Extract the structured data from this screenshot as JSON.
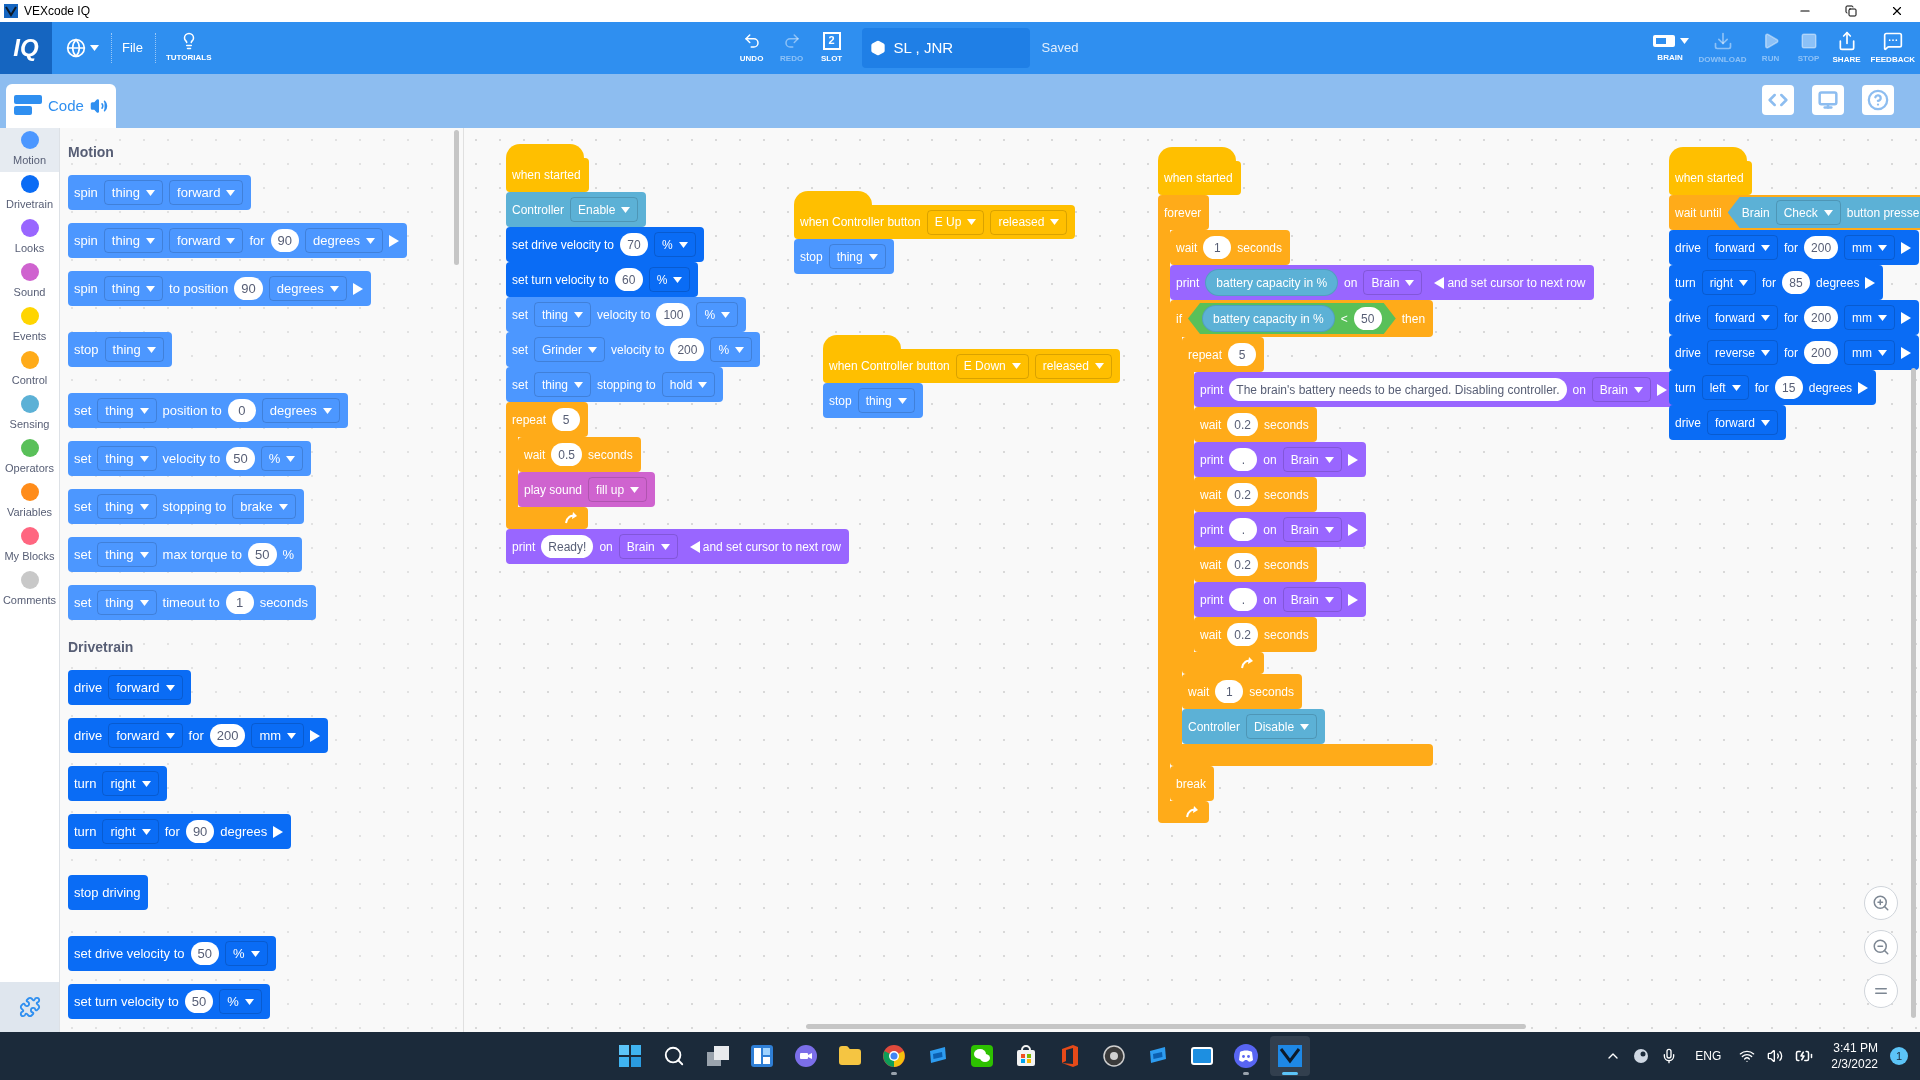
{
  "window": {
    "title": "VEXcode IQ"
  },
  "toolbar": {
    "logo": "IQ",
    "file_menu": "File",
    "tutorials": "TUTORIALS",
    "slot_number": "2",
    "project_name": "SL , JNR",
    "save_status": "Saved",
    "center_buttons": [
      {
        "kind": "undo",
        "label": "UNDO",
        "disabled": false
      },
      {
        "kind": "redo",
        "label": "REDO",
        "disabled": true
      },
      {
        "kind": "slot",
        "label": "SLOT",
        "disabled": false
      }
    ],
    "right_buttons": [
      {
        "kind": "brain",
        "label": "BRAIN",
        "disabled": false
      },
      {
        "kind": "download",
        "label": "DOWNLOAD",
        "disabled": true
      },
      {
        "kind": "run",
        "label": "RUN",
        "disabled": true
      },
      {
        "kind": "stop",
        "label": "STOP",
        "disabled": true
      },
      {
        "kind": "share",
        "label": "SHARE",
        "disabled": false
      },
      {
        "kind": "feedback",
        "label": "FEEDBACK",
        "disabled": false
      }
    ]
  },
  "tabs": [
    {
      "label": "Code",
      "selected": true
    }
  ],
  "categories": [
    {
      "label": "Motion",
      "color": "#4c97ff",
      "selected": true
    },
    {
      "label": "Drivetrain",
      "color": "#0a6cf5",
      "selected": false
    },
    {
      "label": "Looks",
      "color": "#9966ff",
      "selected": false
    },
    {
      "label": "Sound",
      "color": "#cf63cf",
      "selected": false
    },
    {
      "label": "Events",
      "color": "#ffd500",
      "selected": false
    },
    {
      "label": "Control",
      "color": "#ffab19",
      "selected": false
    },
    {
      "label": "Sensing",
      "color": "#5cb1d6",
      "selected": false
    },
    {
      "label": "Operators",
      "color": "#59c059",
      "selected": false
    },
    {
      "label": "Variables",
      "color": "#ff8c1a",
      "selected": false
    },
    {
      "label": "My Blocks",
      "color": "#ff6680",
      "selected": false
    },
    {
      "label": "Comments",
      "color": "#c8c8c8",
      "selected": false
    }
  ],
  "palette": [
    {
      "title": "Motion",
      "blocks": [
        {
          "kind": "stack",
          "color": "#4c97ff",
          "parts": [
            {
              "kind": "text",
              "text": "spin"
            },
            {
              "kind": "dropdown",
              "text": "thing"
            },
            {
              "kind": "dropdown",
              "text": "forward"
            }
          ]
        },
        {
          "kind": "stack",
          "color": "#4c97ff",
          "parts": [
            {
              "kind": "text",
              "text": "spin"
            },
            {
              "kind": "dropdown",
              "text": "thing"
            },
            {
              "kind": "dropdown",
              "text": "forward"
            },
            {
              "kind": "text",
              "text": "for"
            },
            {
              "kind": "number",
              "text": "90"
            },
            {
              "kind": "dropdown",
              "text": "degrees"
            },
            {
              "kind": "expand"
            }
          ]
        },
        {
          "kind": "stack",
          "color": "#4c97ff",
          "parts": [
            {
              "kind": "text",
              "text": "spin"
            },
            {
              "kind": "dropdown",
              "text": "thing"
            },
            {
              "kind": "text",
              "text": "to position"
            },
            {
              "kind": "number",
              "text": "90"
            },
            {
              "kind": "dropdown",
              "text": "degrees"
            },
            {
              "kind": "expand"
            }
          ]
        },
        {
          "kind": "stack",
          "color": "#4c97ff",
          "parts": [
            {
              "kind": "text",
              "text": "stop"
            },
            {
              "kind": "dropdown",
              "text": "thing"
            }
          ]
        },
        {
          "kind": "stack",
          "color": "#4c97ff",
          "parts": [
            {
              "kind": "text",
              "text": "set"
            },
            {
              "kind": "dropdown",
              "text": "thing"
            },
            {
              "kind": "text",
              "text": "position to"
            },
            {
              "kind": "number",
              "text": "0"
            },
            {
              "kind": "dropdown",
              "text": "degrees"
            }
          ]
        },
        {
          "kind": "stack",
          "color": "#4c97ff",
          "parts": [
            {
              "kind": "text",
              "text": "set"
            },
            {
              "kind": "dropdown",
              "text": "thing"
            },
            {
              "kind": "text",
              "text": "velocity to"
            },
            {
              "kind": "number",
              "text": "50"
            },
            {
              "kind": "dropdown",
              "text": "%"
            }
          ]
        },
        {
          "kind": "stack",
          "color": "#4c97ff",
          "parts": [
            {
              "kind": "text",
              "text": "set"
            },
            {
              "kind": "dropdown",
              "text": "thing"
            },
            {
              "kind": "text",
              "text": "stopping to"
            },
            {
              "kind": "dropdown",
              "text": "brake"
            }
          ]
        },
        {
          "kind": "stack",
          "color": "#4c97ff",
          "parts": [
            {
              "kind": "text",
              "text": "set"
            },
            {
              "kind": "dropdown",
              "text": "thing"
            },
            {
              "kind": "text",
              "text": "max torque to"
            },
            {
              "kind": "number",
              "text": "50"
            },
            {
              "kind": "text",
              "text": "%"
            }
          ]
        },
        {
          "kind": "stack",
          "color": "#4c97ff",
          "parts": [
            {
              "kind": "text",
              "text": "set"
            },
            {
              "kind": "dropdown",
              "text": "thing"
            },
            {
              "kind": "text",
              "text": "timeout to"
            },
            {
              "kind": "number",
              "text": "1"
            },
            {
              "kind": "text",
              "text": "seconds"
            }
          ]
        }
      ]
    },
    {
      "title": "Drivetrain",
      "blocks": [
        {
          "kind": "stack",
          "color": "#0a6cf5",
          "parts": [
            {
              "kind": "text",
              "text": "drive"
            },
            {
              "kind": "dropdown",
              "text": "forward"
            }
          ]
        },
        {
          "kind": "stack",
          "color": "#0a6cf5",
          "parts": [
            {
              "kind": "text",
              "text": "drive"
            },
            {
              "kind": "dropdown",
              "text": "forward"
            },
            {
              "kind": "text",
              "text": "for"
            },
            {
              "kind": "number",
              "text": "200"
            },
            {
              "kind": "dropdown",
              "text": "mm"
            },
            {
              "kind": "expand"
            }
          ]
        },
        {
          "kind": "stack",
          "color": "#0a6cf5",
          "parts": [
            {
              "kind": "text",
              "text": "turn"
            },
            {
              "kind": "dropdown",
              "text": "right"
            }
          ]
        },
        {
          "kind": "stack",
          "color": "#0a6cf5",
          "parts": [
            {
              "kind": "text",
              "text": "turn"
            },
            {
              "kind": "dropdown",
              "text": "right"
            },
            {
              "kind": "text",
              "text": "for"
            },
            {
              "kind": "number",
              "text": "90"
            },
            {
              "kind": "text",
              "text": "degrees"
            },
            {
              "kind": "expand"
            }
          ]
        },
        {
          "kind": "stack",
          "color": "#0a6cf5",
          "parts": [
            {
              "kind": "text",
              "text": "stop driving"
            }
          ]
        },
        {
          "kind": "stack",
          "color": "#0a6cf5",
          "parts": [
            {
              "kind": "text",
              "text": "set drive velocity to"
            },
            {
              "kind": "number",
              "text": "50"
            },
            {
              "kind": "dropdown",
              "text": "%"
            }
          ]
        },
        {
          "kind": "stack",
          "color": "#0a6cf5",
          "parts": [
            {
              "kind": "text",
              "text": "set turn velocity to"
            },
            {
              "kind": "number",
              "text": "50"
            },
            {
              "kind": "dropdown",
              "text": "%"
            }
          ]
        }
      ]
    }
  ],
  "scripts": [
    {
      "blocks": [
        {
          "kind": "hat",
          "color": "#ffbf00",
          "parts": [
            {
              "kind": "text",
              "text": "when started"
            }
          ]
        },
        {
          "kind": "stack",
          "color": "#5cb1d6",
          "parts": [
            {
              "kind": "text",
              "text": "Controller"
            },
            {
              "kind": "dropdown",
              "text": "Enable"
            }
          ]
        },
        {
          "kind": "stack",
          "color": "#0a6cf5",
          "parts": [
            {
              "kind": "text",
              "text": "set drive velocity to"
            },
            {
              "kind": "number",
              "text": "70"
            },
            {
              "kind": "dropdown",
              "text": "%"
            }
          ]
        },
        {
          "kind": "stack",
          "color": "#0a6cf5",
          "parts": [
            {
              "kind": "text",
              "text": "set turn velocity to"
            },
            {
              "kind": "number",
              "text": "60"
            },
            {
              "kind": "dropdown",
              "text": "%"
            }
          ]
        },
        {
          "kind": "stack",
          "color": "#4c97ff",
          "parts": [
            {
              "kind": "text",
              "text": "set"
            },
            {
              "kind": "dropdown",
              "text": "thing"
            },
            {
              "kind": "text",
              "text": "velocity to"
            },
            {
              "kind": "number",
              "text": "100"
            },
            {
              "kind": "dropdown",
              "text": "%"
            }
          ]
        },
        {
          "kind": "stack",
          "color": "#4c97ff",
          "parts": [
            {
              "kind": "text",
              "text": "set"
            },
            {
              "kind": "dropdown",
              "text": "Grinder"
            },
            {
              "kind": "text",
              "text": "velocity to"
            },
            {
              "kind": "number",
              "text": "200"
            },
            {
              "kind": "dropdown",
              "text": "%"
            }
          ]
        },
        {
          "kind": "stack",
          "color": "#4c97ff",
          "parts": [
            {
              "kind": "text",
              "text": "set"
            },
            {
              "kind": "dropdown",
              "text": "thing"
            },
            {
              "kind": "text",
              "text": "stopping to"
            },
            {
              "kind": "dropdown",
              "text": "hold"
            }
          ]
        },
        {
          "kind": "loop",
          "color": "#ffab19",
          "parts": [
            {
              "kind": "text",
              "text": "repeat"
            },
            {
              "kind": "number",
              "text": "5"
            }
          ],
          "children": [
            {
              "kind": "stack",
              "color": "#ffab19",
              "parts": [
                {
                  "kind": "text",
                  "text": "wait"
                },
                {
                  "kind": "number",
                  "text": "0.5"
                },
                {
                  "kind": "text",
                  "text": "seconds"
                }
              ]
            },
            {
              "kind": "stack",
              "color": "#cf63cf",
              "parts": [
                {
                  "kind": "text",
                  "text": "play sound"
                },
                {
                  "kind": "dropdown",
                  "text": "fill up"
                }
              ]
            }
          ]
        },
        {
          "kind": "stack",
          "color": "#9966ff",
          "parts": [
            {
              "kind": "text",
              "text": "print"
            },
            {
              "kind": "number",
              "text": "Ready!"
            },
            {
              "kind": "text",
              "text": "on"
            },
            {
              "kind": "dropdown",
              "text": "Brain"
            },
            {
              "kind": "collapse",
              "text": "and set cursor to next row"
            }
          ]
        }
      ]
    },
    {
      "blocks": [
        {
          "kind": "hat",
          "color": "#ffbf00",
          "parts": [
            {
              "kind": "text",
              "text": "when Controller button"
            },
            {
              "kind": "dropdown",
              "text": "E Up"
            },
            {
              "kind": "dropdown",
              "text": "released"
            }
          ]
        },
        {
          "kind": "stack",
          "color": "#4c97ff",
          "parts": [
            {
              "kind": "text",
              "text": "stop"
            },
            {
              "kind": "dropdown",
              "text": "thing"
            }
          ]
        }
      ]
    },
    {
      "blocks": [
        {
          "kind": "hat",
          "color": "#ffbf00",
          "parts": [
            {
              "kind": "text",
              "text": "when Controller button"
            },
            {
              "kind": "dropdown",
              "text": "E Down"
            },
            {
              "kind": "dropdown",
              "text": "released"
            }
          ]
        },
        {
          "kind": "stack",
          "color": "#4c97ff",
          "parts": [
            {
              "kind": "text",
              "text": "stop"
            },
            {
              "kind": "dropdown",
              "text": "thing"
            }
          ]
        }
      ]
    },
    {
      "blocks": [
        {
          "kind": "hat",
          "color": "#ffbf00",
          "parts": [
            {
              "kind": "text",
              "text": "when started"
            }
          ]
        },
        {
          "kind": "loop",
          "color": "#ffab19",
          "parts": [
            {
              "kind": "text",
              "text": "forever"
            }
          ],
          "children": [
            {
              "kind": "stack",
              "color": "#ffab19",
              "parts": [
                {
                  "kind": "text",
                  "text": "wait"
                },
                {
                  "kind": "number",
                  "text": "1"
                },
                {
                  "kind": "text",
                  "text": "seconds"
                }
              ]
            },
            {
              "kind": "stack",
              "color": "#9966ff",
              "parts": [
                {
                  "kind": "text",
                  "text": "print"
                },
                {
                  "kind": "reporter",
                  "color": "#5cb1d6",
                  "text": "battery capacity in %"
                },
                {
                  "kind": "text",
                  "text": "on"
                },
                {
                  "kind": "dropdown",
                  "text": "Brain"
                },
                {
                  "kind": "collapse",
                  "text": "and set cursor to next row"
                }
              ]
            },
            {
              "kind": "if",
              "color": "#ffab19",
              "parts": [
                {
                  "kind": "text",
                  "text": "if"
                },
                {
                  "kind": "condition",
                  "color": "#59c059",
                  "parts": [
                    {
                      "kind": "reporter",
                      "color": "#5cb1d6",
                      "text": "battery capacity in %"
                    },
                    {
                      "kind": "text",
                      "text": "<"
                    },
                    {
                      "kind": "number",
                      "text": "50"
                    }
                  ]
                },
                {
                  "kind": "text",
                  "text": "then"
                }
              ],
              "children": [
                {
                  "kind": "loop",
                  "color": "#ffab19",
                  "parts": [
                    {
                      "kind": "text",
                      "text": "repeat"
                    },
                    {
                      "kind": "number",
                      "text": "5"
                    }
                  ],
                  "children": [
                    {
                      "kind": "stack",
                      "color": "#9966ff",
                      "parts": [
                        {
                          "kind": "text",
                          "text": "print"
                        },
                        {
                          "kind": "number",
                          "text": "The brain's battery needs to be charged. Disabling controller."
                        },
                        {
                          "kind": "text",
                          "text": "on"
                        },
                        {
                          "kind": "dropdown",
                          "text": "Brain"
                        },
                        {
                          "kind": "expand"
                        }
                      ]
                    },
                    {
                      "kind": "stack",
                      "color": "#ffab19",
                      "parts": [
                        {
                          "kind": "text",
                          "text": "wait"
                        },
                        {
                          "kind": "number",
                          "text": "0.2"
                        },
                        {
                          "kind": "text",
                          "text": "seconds"
                        }
                      ]
                    },
                    {
                      "kind": "stack",
                      "color": "#9966ff",
                      "parts": [
                        {
                          "kind": "text",
                          "text": "print"
                        },
                        {
                          "kind": "number",
                          "text": "."
                        },
                        {
                          "kind": "text",
                          "text": "on"
                        },
                        {
                          "kind": "dropdown",
                          "text": "Brain"
                        },
                        {
                          "kind": "expand"
                        }
                      ]
                    },
                    {
                      "kind": "stack",
                      "color": "#ffab19",
                      "parts": [
                        {
                          "kind": "text",
                          "text": "wait"
                        },
                        {
                          "kind": "number",
                          "text": "0.2"
                        },
                        {
                          "kind": "text",
                          "text": "seconds"
                        }
                      ]
                    },
                    {
                      "kind": "stack",
                      "color": "#9966ff",
                      "parts": [
                        {
                          "kind": "text",
                          "text": "print"
                        },
                        {
                          "kind": "number",
                          "text": "."
                        },
                        {
                          "kind": "text",
                          "text": "on"
                        },
                        {
                          "kind": "dropdown",
                          "text": "Brain"
                        },
                        {
                          "kind": "expand"
                        }
                      ]
                    },
                    {
                      "kind": "stack",
                      "color": "#ffab19",
                      "parts": [
                        {
                          "kind": "text",
                          "text": "wait"
                        },
                        {
                          "kind": "number",
                          "text": "0.2"
                        },
                        {
                          "kind": "text",
                          "text": "seconds"
                        }
                      ]
                    },
                    {
                      "kind": "stack",
                      "color": "#9966ff",
                      "parts": [
                        {
                          "kind": "text",
                          "text": "print"
                        },
                        {
                          "kind": "number",
                          "text": "."
                        },
                        {
                          "kind": "text",
                          "text": "on"
                        },
                        {
                          "kind": "dropdown",
                          "text": "Brain"
                        },
                        {
                          "kind": "expand"
                        }
                      ]
                    },
                    {
                      "kind": "stack",
                      "color": "#ffab19",
                      "parts": [
                        {
                          "kind": "text",
                          "text": "wait"
                        },
                        {
                          "kind": "number",
                          "text": "0.2"
                        },
                        {
                          "kind": "text",
                          "text": "seconds"
                        }
                      ]
                    }
                  ]
                },
                {
                  "kind": "stack",
                  "color": "#ffab19",
                  "parts": [
                    {
                      "kind": "text",
                      "text": "wait"
                    },
                    {
                      "kind": "number",
                      "text": "1"
                    },
                    {
                      "kind": "text",
                      "text": "seconds"
                    }
                  ]
                },
                {
                  "kind": "stack",
                  "color": "#5cb1d6",
                  "parts": [
                    {
                      "kind": "text",
                      "text": "Controller"
                    },
                    {
                      "kind": "dropdown",
                      "text": "Disable"
                    }
                  ]
                }
              ]
            },
            {
              "kind": "stack",
              "color": "#ffab19",
              "parts": [
                {
                  "kind": "text",
                  "text": "break"
                }
              ]
            }
          ]
        }
      ]
    },
    {
      "blocks": [
        {
          "kind": "hat",
          "color": "#ffbf00",
          "parts": [
            {
              "kind": "text",
              "text": "when started"
            }
          ]
        },
        {
          "kind": "stack",
          "color": "#ffab19",
          "parts": [
            {
              "kind": "text",
              "text": "wait until"
            },
            {
              "kind": "condition",
              "color": "#5cb1d6",
              "parts": [
                {
                  "kind": "text",
                  "text": "Brain"
                },
                {
                  "kind": "dropdown",
                  "text": "Check"
                },
                {
                  "kind": "text",
                  "text": "button presse"
                }
              ]
            }
          ]
        },
        {
          "kind": "stack",
          "color": "#0a6cf5",
          "parts": [
            {
              "kind": "text",
              "text": "drive"
            },
            {
              "kind": "dropdown",
              "text": "forward"
            },
            {
              "kind": "text",
              "text": "for"
            },
            {
              "kind": "number",
              "text": "200"
            },
            {
              "kind": "dropdown",
              "text": "mm"
            },
            {
              "kind": "expand"
            }
          ]
        },
        {
          "kind": "stack",
          "color": "#0a6cf5",
          "parts": [
            {
              "kind": "text",
              "text": "turn"
            },
            {
              "kind": "dropdown",
              "text": "right"
            },
            {
              "kind": "text",
              "text": "for"
            },
            {
              "kind": "number",
              "text": "85"
            },
            {
              "kind": "text",
              "text": "degrees"
            },
            {
              "kind": "expand"
            }
          ]
        },
        {
          "kind": "stack",
          "color": "#0a6cf5",
          "parts": [
            {
              "kind": "text",
              "text": "drive"
            },
            {
              "kind": "dropdown",
              "text": "forward"
            },
            {
              "kind": "text",
              "text": "for"
            },
            {
              "kind": "number",
              "text": "200"
            },
            {
              "kind": "dropdown",
              "text": "mm"
            },
            {
              "kind": "expand"
            }
          ]
        },
        {
          "kind": "stack",
          "color": "#0a6cf5",
          "parts": [
            {
              "kind": "text",
              "text": "drive"
            },
            {
              "kind": "dropdown",
              "text": "reverse"
            },
            {
              "kind": "text",
              "text": "for"
            },
            {
              "kind": "number",
              "text": "200"
            },
            {
              "kind": "dropdown",
              "text": "mm"
            },
            {
              "kind": "expand"
            }
          ]
        },
        {
          "kind": "stack",
          "color": "#0a6cf5",
          "parts": [
            {
              "kind": "text",
              "text": "turn"
            },
            {
              "kind": "dropdown",
              "text": "left"
            },
            {
              "kind": "text",
              "text": "for"
            },
            {
              "kind": "number",
              "text": "15"
            },
            {
              "kind": "text",
              "text": "degrees"
            },
            {
              "kind": "expand"
            }
          ]
        },
        {
          "kind": "stack",
          "color": "#0a6cf5",
          "parts": [
            {
              "kind": "text",
              "text": "drive"
            },
            {
              "kind": "dropdown",
              "text": "forward"
            }
          ]
        }
      ]
    }
  ],
  "taskbar": {
    "apps": [
      {
        "kind": "start",
        "running": false,
        "selected": false
      },
      {
        "kind": "search",
        "running": false,
        "selected": false
      },
      {
        "kind": "taskview",
        "running": false,
        "selected": false
      },
      {
        "kind": "widgets",
        "running": false,
        "selected": false
      },
      {
        "kind": "chat",
        "running": false,
        "selected": false
      },
      {
        "kind": "explorer",
        "running": false,
        "selected": false
      },
      {
        "kind": "browser",
        "running": true,
        "selected": false
      },
      {
        "kind": "bluetile",
        "running": false,
        "selected": false
      },
      {
        "kind": "wechat",
        "running": false,
        "selected": false
      },
      {
        "kind": "store",
        "running": false,
        "selected": false
      },
      {
        "kind": "office",
        "running": false,
        "selected": false
      },
      {
        "kind": "aperture",
        "running": false,
        "selected": false
      },
      {
        "kind": "bluetile",
        "running": false,
        "selected": false
      },
      {
        "kind": "mail",
        "running": false,
        "selected": false
      },
      {
        "kind": "discord",
        "running": true,
        "selected": false
      },
      {
        "kind": "vex",
        "running": true,
        "selected": true
      }
    ],
    "language": "ENG",
    "time": "3:41 PM",
    "date": "2/3/2022",
    "notifications": "1"
  }
}
